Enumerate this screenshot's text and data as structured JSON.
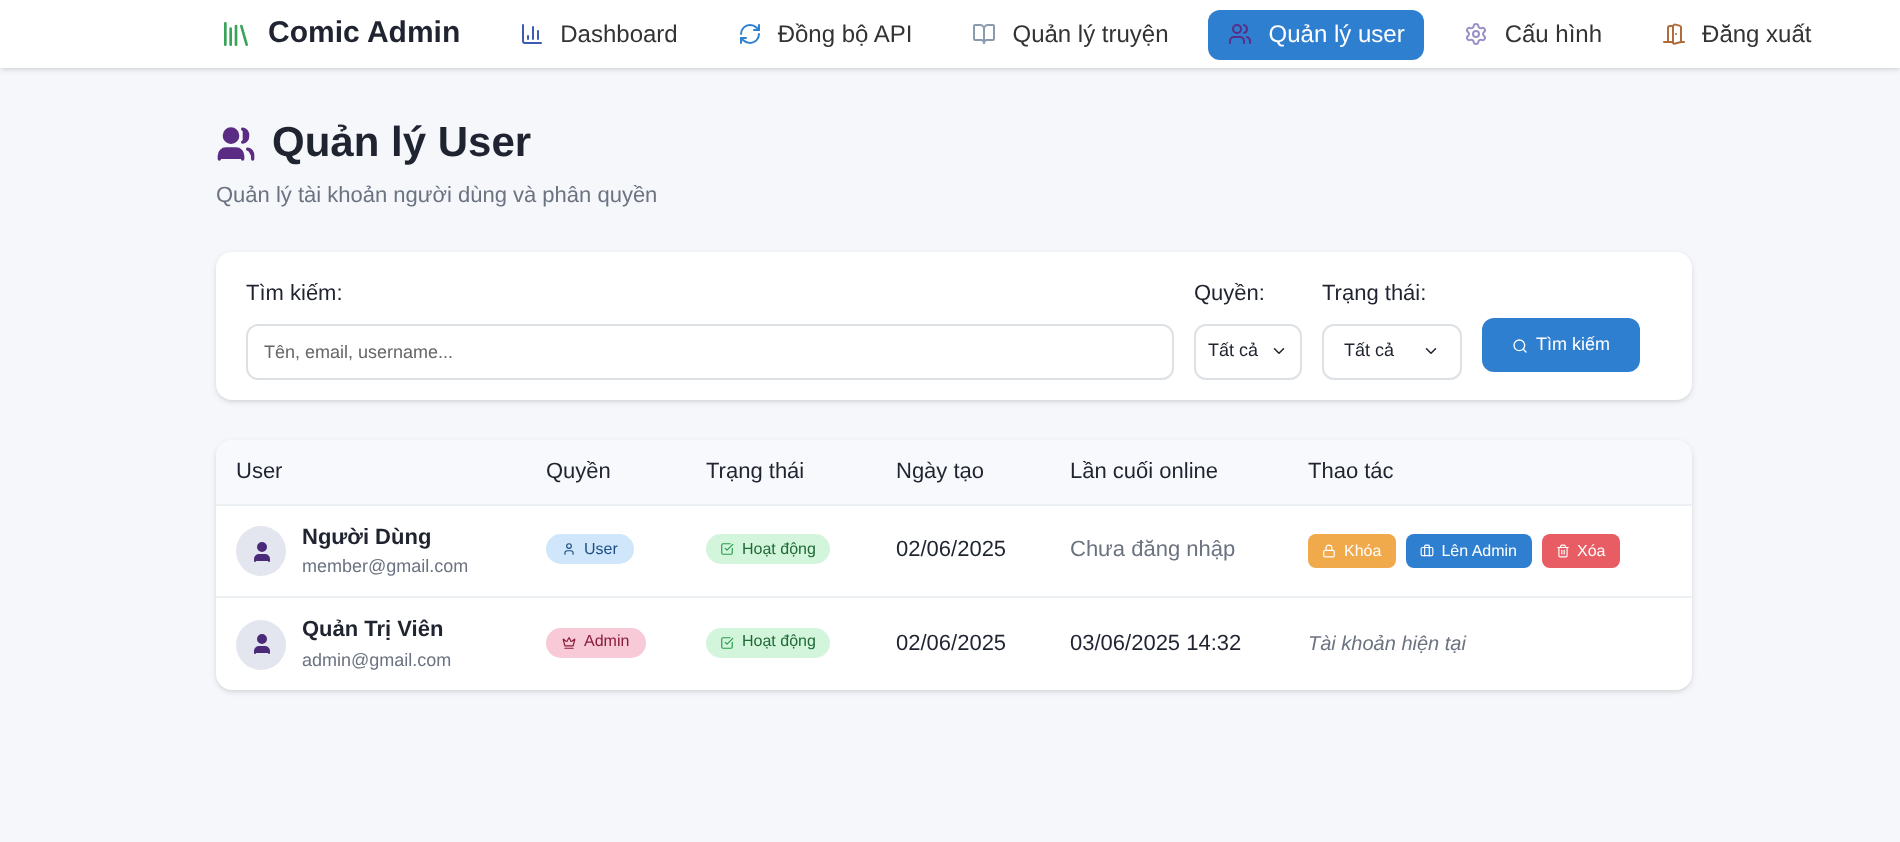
{
  "brand": "Comic Admin",
  "nav": [
    {
      "label": "Dashboard",
      "kind": "dashboard",
      "selected": false
    },
    {
      "label": "Đồng bộ API",
      "kind": "sync",
      "selected": false
    },
    {
      "label": "Quản lý truyện",
      "kind": "comics",
      "selected": false
    },
    {
      "label": "Quản lý user",
      "kind": "users",
      "selected": true
    },
    {
      "label": "Cấu hình",
      "kind": "settings",
      "selected": false
    },
    {
      "label": "Đăng xuất",
      "kind": "logout",
      "selected": false
    }
  ],
  "page": {
    "title": "Quản lý User",
    "subtitle": "Quản lý tài khoản người dùng và phân quyền"
  },
  "filters": {
    "search_label": "Tìm kiếm:",
    "search_placeholder": "Tên, email, username...",
    "role_label": "Quyền:",
    "role_value": "Tất cả",
    "status_label": "Trạng thái:",
    "status_value": "Tất cả",
    "button": "Tìm kiếm"
  },
  "table": {
    "columns": [
      "User",
      "Quyền",
      "Trạng thái",
      "Ngày tạo",
      "Lần cuối online",
      "Thao tác"
    ],
    "rows": [
      {
        "name": "Người Dùng",
        "email": "member@gmail.com",
        "role": {
          "kind": "user",
          "label": "User"
        },
        "status": "Hoạt động",
        "created": "02/06/2025",
        "last_online": {
          "kind": "never",
          "text": "Chưa đăng nhập"
        },
        "actions": {
          "kind": "buttons",
          "buttons": [
            {
              "kind": "lock",
              "label": "Khóa"
            },
            {
              "kind": "promote",
              "label": "Lên Admin"
            },
            {
              "kind": "delete",
              "label": "Xóa"
            }
          ]
        }
      },
      {
        "name": "Quản Trị Viên",
        "email": "admin@gmail.com",
        "role": {
          "kind": "admin",
          "label": "Admin"
        },
        "status": "Hoạt động",
        "created": "02/06/2025",
        "last_online": {
          "kind": "date",
          "text": "03/06/2025 14:32"
        },
        "actions": {
          "kind": "note",
          "text": "Tài khoản hiện tại"
        }
      }
    ]
  }
}
